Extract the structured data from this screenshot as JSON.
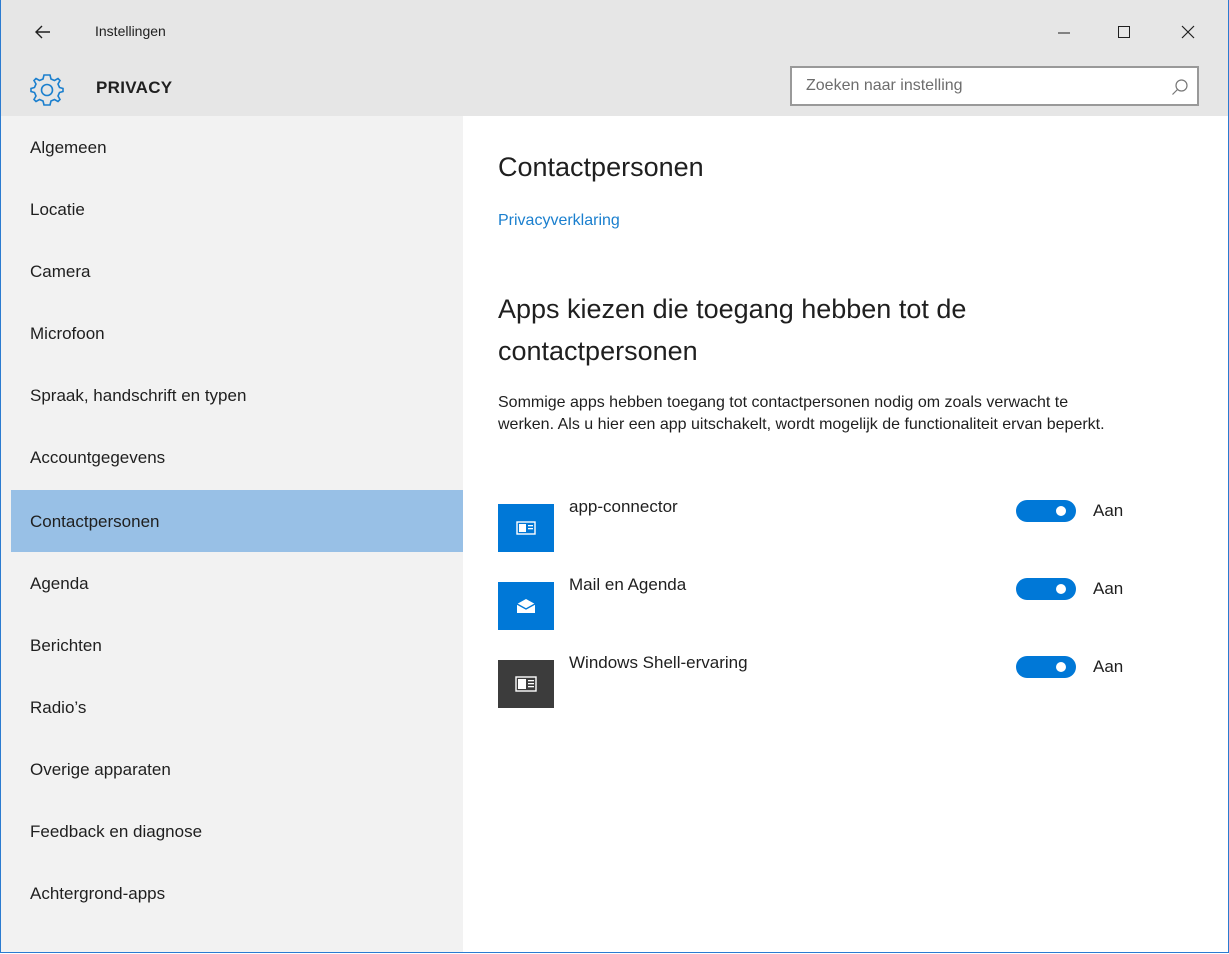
{
  "window": {
    "title": "Instellingen",
    "back_icon": "back-arrow-icon",
    "controls": [
      "minimize-icon",
      "maximize-icon",
      "close-icon"
    ]
  },
  "header": {
    "icon": "gear-icon",
    "section_title": "PRIVACY",
    "search": {
      "placeholder": "Zoeken naar instelling",
      "icon": "search-icon"
    }
  },
  "sidebar": {
    "items": [
      {
        "label": "Algemeen"
      },
      {
        "label": "Locatie"
      },
      {
        "label": "Camera"
      },
      {
        "label": "Microfoon"
      },
      {
        "label": "Spraak, handschrift en typen"
      },
      {
        "label": "Accountgegevens"
      },
      {
        "label": "Contactpersonen",
        "selected": true
      },
      {
        "label": "Agenda"
      },
      {
        "label": "Berichten"
      },
      {
        "label": "Radio’s"
      },
      {
        "label": "Overige apparaten"
      },
      {
        "label": "Feedback en diagnose"
      },
      {
        "label": "Achtergrond-apps"
      }
    ]
  },
  "main": {
    "title": "Contactpersonen",
    "privacy_link": "Privacyverklaring",
    "section_heading": "Apps kiezen die toegang hebben tot de contactpersonen",
    "description": "Sommige apps hebben toegang tot contactpersonen nodig om zoals verwacht te werken. Als u hier een app uitschakelt, wordt mogelijk de functionaliteit ervan beperkt.",
    "apps": [
      {
        "name": "app-connector",
        "icon": "app-connector-icon",
        "icon_bg": "#0078d7",
        "toggle_state": "on",
        "toggle_label": "Aan"
      },
      {
        "name": "Mail en Agenda",
        "icon": "mail-icon",
        "icon_bg": "#0078d7",
        "toggle_state": "on",
        "toggle_label": "Aan"
      },
      {
        "name": "Windows Shell-ervaring",
        "icon": "shell-window-icon",
        "icon_bg": "#3c3c3c",
        "toggle_state": "on",
        "toggle_label": "Aan"
      }
    ]
  },
  "colors": {
    "accent": "#0078d7",
    "link": "#1a7fce",
    "selected_nav": "#98c0e6",
    "sidebar_bg": "#f2f2f2",
    "titlebar_bg": "#e6e6e6"
  }
}
